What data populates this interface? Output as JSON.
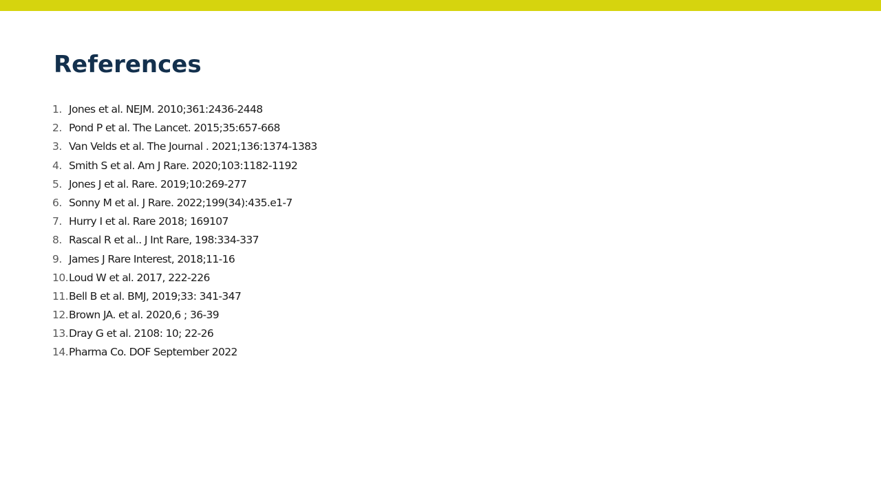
{
  "slide": {
    "title": "References",
    "accent_color": "#d6d40e",
    "title_color": "#13304d"
  },
  "references": [
    {
      "num": "1.",
      "text": "Jones et al. NEJM. 2010;361:2436-2448"
    },
    {
      "num": "2.",
      "text": "Pond P et al. The Lancet. 2015;35:657-668"
    },
    {
      "num": "3.",
      "text": "Van Velds et al. The Journal . 2021;136:1374-1383"
    },
    {
      "num": "4.",
      "text": "Smith S et al. Am J Rare. 2020;103:1182-1192"
    },
    {
      "num": "5.",
      "text": "Jones J et al. Rare. 2019;10:269-277"
    },
    {
      "num": "6.",
      "text": "Sonny M  et al. J Rare. 2022;199(34):435.e1-7"
    },
    {
      "num": "7.",
      "text": "Hurry I et al. Rare 2018; 169107"
    },
    {
      "num": "8.",
      "text": "Rascal R et al.. J  Int Rare, 198:334-337"
    },
    {
      "num": "9.",
      "text": "James J Rare Interest,  2018;11-16"
    },
    {
      "num": "10.",
      "text": "Loud W et al. 2017, 222-226"
    },
    {
      "num": "11.",
      "text": "Bell B et al. BMJ, 2019;33: 341-347"
    },
    {
      "num": "12.",
      "text": "Brown JA. et al. 2020,6 ; 36-39"
    },
    {
      "num": "13.",
      "text": "Dray G et al.  2108: 10; 22-26"
    },
    {
      "num": "14.",
      "text": "Pharma Co. DOF September  2022"
    }
  ]
}
